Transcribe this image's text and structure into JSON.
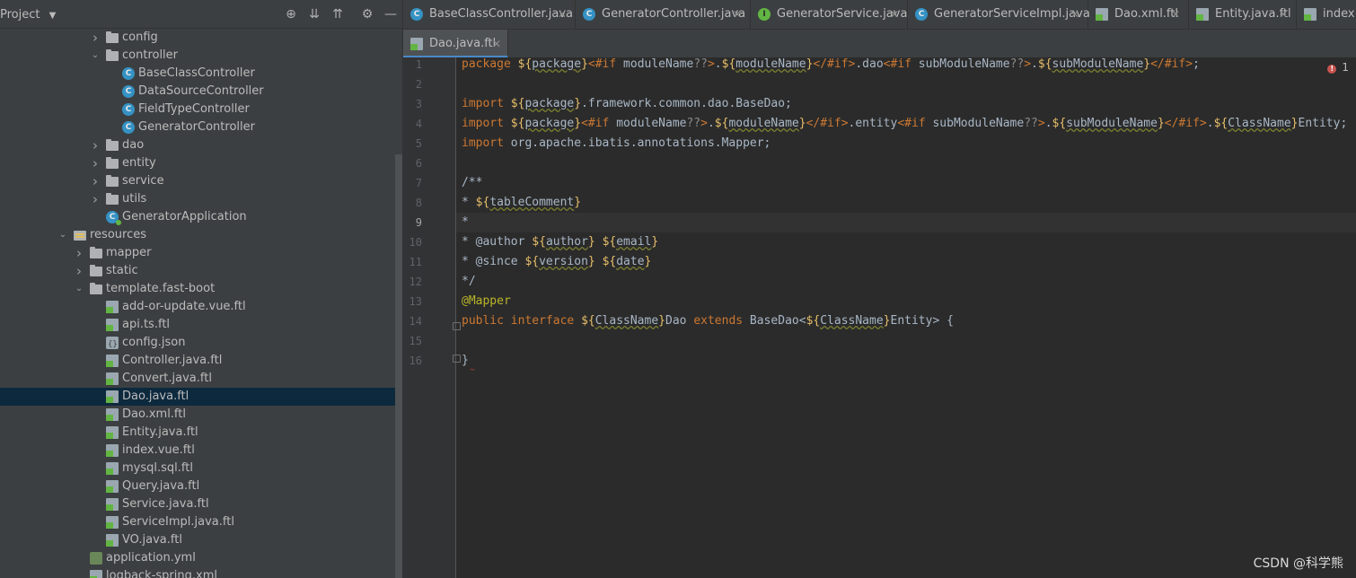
{
  "project_panel": {
    "title": "Project",
    "toolbar": [
      "locate-icon",
      "expand-all-icon",
      "collapse-all-icon",
      "gear-icon",
      "minimize-icon"
    ],
    "tree": [
      {
        "label": "config",
        "type": "folder",
        "indent": 1,
        "expanded": false
      },
      {
        "label": "controller",
        "type": "folder",
        "indent": 1,
        "expanded": true
      },
      {
        "label": "BaseClassController",
        "type": "class",
        "indent": 2
      },
      {
        "label": "DataSourceController",
        "type": "class",
        "indent": 2
      },
      {
        "label": "FieldTypeController",
        "type": "class",
        "indent": 2
      },
      {
        "label": "GeneratorController",
        "type": "class",
        "indent": 2
      },
      {
        "label": "dao",
        "type": "folder",
        "indent": 1,
        "expanded": false
      },
      {
        "label": "entity",
        "type": "folder",
        "indent": 1,
        "expanded": false
      },
      {
        "label": "service",
        "type": "folder",
        "indent": 1,
        "expanded": false
      },
      {
        "label": "utils",
        "type": "folder",
        "indent": 1,
        "expanded": false
      },
      {
        "label": "GeneratorApplication",
        "type": "app-class",
        "indent": 1
      },
      {
        "label": "resources",
        "type": "res-folder",
        "indent": -1,
        "expanded": true
      },
      {
        "label": "mapper",
        "type": "folder",
        "indent": 0,
        "expanded": false
      },
      {
        "label": "static",
        "type": "folder",
        "indent": 0,
        "expanded": false
      },
      {
        "label": "template.fast-boot",
        "type": "folder",
        "indent": 0,
        "expanded": true
      },
      {
        "label": "add-or-update.vue.ftl",
        "type": "ftl",
        "indent": 1
      },
      {
        "label": "api.ts.ftl",
        "type": "ftl",
        "indent": 1
      },
      {
        "label": "config.json",
        "type": "json",
        "indent": 1
      },
      {
        "label": "Controller.java.ftl",
        "type": "ftl",
        "indent": 1
      },
      {
        "label": "Convert.java.ftl",
        "type": "ftl",
        "indent": 1
      },
      {
        "label": "Dao.java.ftl",
        "type": "ftl",
        "indent": 1,
        "selected": true
      },
      {
        "label": "Dao.xml.ftl",
        "type": "ftl",
        "indent": 1
      },
      {
        "label": "Entity.java.ftl",
        "type": "ftl",
        "indent": 1
      },
      {
        "label": "index.vue.ftl",
        "type": "ftl",
        "indent": 1
      },
      {
        "label": "mysql.sql.ftl",
        "type": "ftl",
        "indent": 1
      },
      {
        "label": "Query.java.ftl",
        "type": "ftl",
        "indent": 1
      },
      {
        "label": "Service.java.ftl",
        "type": "ftl",
        "indent": 1
      },
      {
        "label": "ServiceImpl.java.ftl",
        "type": "ftl",
        "indent": 1
      },
      {
        "label": "VO.java.ftl",
        "type": "ftl",
        "indent": 1
      },
      {
        "label": "application.yml",
        "type": "yml",
        "indent": 0
      },
      {
        "label": "logback-spring.xml",
        "type": "ftl",
        "indent": 0
      }
    ]
  },
  "tabs": [
    {
      "label": "BaseClassController.java",
      "icon": "class"
    },
    {
      "label": "GeneratorController.java",
      "icon": "class"
    },
    {
      "label": "GeneratorService.java",
      "icon": "interface"
    },
    {
      "label": "GeneratorServiceImpl.java",
      "icon": "class"
    },
    {
      "label": "Dao.xml.ftl",
      "icon": "ftl"
    },
    {
      "label": "Entity.java.ftl",
      "icon": "ftl"
    },
    {
      "label": "index.v",
      "icon": "ftl"
    }
  ],
  "active_tab": {
    "label": "Dao.java.ftl",
    "icon": "ftl"
  },
  "editor": {
    "line_numbers": [
      "1",
      "2",
      "3",
      "4",
      "5",
      "6",
      "7",
      "8",
      "9",
      "10",
      "11",
      "12",
      "13",
      "14",
      "15",
      "16"
    ],
    "error_count": "1",
    "current_line": "9"
  },
  "watermark": "CSDN @科学熊",
  "colors": {
    "panel_bg": "#3c3f41",
    "editor_bg": "#2b2b2b",
    "selection": "#0d293e",
    "keyword": "#cc7832",
    "freemarker_dollar": "#e8bf6a",
    "annotation": "#bbb529",
    "accent": "#4a88c7"
  }
}
